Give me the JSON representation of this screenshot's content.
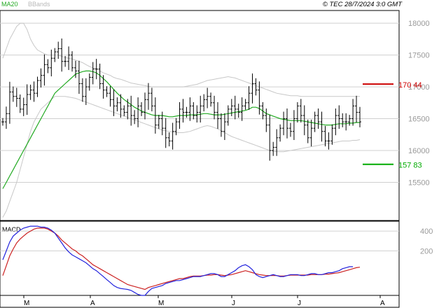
{
  "header": {
    "legend_ma": "MA20",
    "legend_bb": "BBands",
    "copyright": "© TEC 28/7/2024 3:0 GMT"
  },
  "colors": {
    "ma": "#22aa22",
    "bb": "#c8c8c8",
    "price": "#000000",
    "macd": "#2222dd",
    "signal": "#cc2222",
    "resistance": "#cc0000",
    "support": "#00aa00",
    "grid": "#d0d0d0",
    "axis_text": "#9a9a9a"
  },
  "chart_data": [
    {
      "type": "ohlc",
      "price_ticks": [
        15500,
        16000,
        16500,
        17000,
        17500,
        18000
      ],
      "price_tick_labels": [
        "15500",
        "16000",
        "16500",
        "17000",
        "17500",
        "18000"
      ],
      "ylim": [
        14900,
        18200
      ],
      "x_labels": [
        "M",
        "A",
        "M",
        "J",
        "J",
        "A"
      ],
      "levels": [
        {
          "name": "resistance",
          "value": 17044,
          "label": "170 44"
        },
        {
          "name": "support",
          "value": 15783,
          "label": "157 83"
        }
      ],
      "close": [
        16450,
        16580,
        16920,
        16850,
        16820,
        16650,
        16720,
        16880,
        16950,
        16900,
        17100,
        17180,
        17350,
        17300,
        17450,
        17550,
        17600,
        17400,
        17400,
        17500,
        17300,
        17250,
        17050,
        16850,
        17000,
        17150,
        17280,
        17280,
        17050,
        16950,
        16900,
        16800,
        16700,
        16750,
        16650,
        16600,
        16700,
        16550,
        16500,
        16700,
        16600,
        16800,
        16900,
        16700,
        16400,
        16500,
        16350,
        16200,
        16150,
        16300,
        16450,
        16650,
        16600,
        16600,
        16700,
        16550,
        16600,
        16700,
        16800,
        16850,
        16750,
        16600,
        16500,
        16300,
        16450,
        16650,
        16700,
        16650,
        16600,
        16700,
        16750,
        16900,
        17050,
        16950,
        16700,
        16550,
        16400,
        16000,
        16050,
        16200,
        16350,
        16500,
        16350,
        16300,
        16500,
        16700,
        16550,
        16400,
        16200,
        16350,
        16550,
        16450,
        16300,
        16150,
        16150,
        16350,
        16550,
        16500,
        16450,
        16450,
        16500,
        16700,
        16600,
        16450
      ],
      "ma20": [
        15400,
        15500,
        15600,
        15700,
        15800,
        15900,
        16000,
        16100,
        16200,
        16300,
        16400,
        16500,
        16600,
        16700,
        16800,
        16900,
        16950,
        17000,
        17050,
        17100,
        17150,
        17200,
        17220,
        17240,
        17250,
        17250,
        17240,
        17220,
        17180,
        17130,
        17080,
        17020,
        16960,
        16900,
        16850,
        16800,
        16760,
        16720,
        16680,
        16650,
        16620,
        16600,
        16580,
        16560,
        16550,
        16550,
        16550,
        16540,
        16530,
        16530,
        16540,
        16550,
        16550,
        16550,
        16560,
        16560,
        16560,
        16570,
        16580,
        16580,
        16570,
        16560,
        16560,
        16560,
        16570,
        16580,
        16590,
        16600,
        16610,
        16620,
        16630,
        16650,
        16680,
        16680,
        16660,
        16620,
        16580,
        16560,
        16540,
        16520,
        16500,
        16490,
        16480,
        16470,
        16470,
        16470,
        16470,
        16460,
        16450,
        16440,
        16430,
        16420,
        16410,
        16400,
        16400,
        16400,
        16410,
        16420,
        16420,
        16420,
        16430,
        16430,
        16440,
        16440
      ],
      "bb_upper": [
        17450,
        17600,
        17750,
        17850,
        17950,
        18000,
        18000,
        17900,
        17750,
        17650,
        17580,
        17550,
        17520,
        17500,
        17500,
        17500,
        17500,
        17480,
        17460,
        17450,
        17440,
        17420,
        17400,
        17380,
        17350,
        17320,
        17300,
        17280,
        17250,
        17220,
        17200,
        17180,
        17150,
        17130,
        17120,
        17100,
        17080,
        17060,
        17050,
        17040,
        17030,
        17020,
        17010,
        17000,
        17000,
        17000,
        17000,
        17000,
        17000,
        17000,
        17000,
        17000,
        17000,
        17010,
        17020,
        17030,
        17040,
        17060,
        17080,
        17100,
        17110,
        17120,
        17130,
        17140,
        17150,
        17160,
        17150,
        17140,
        17120,
        17100,
        17080,
        17060,
        17040,
        17020,
        17000,
        16980,
        16960,
        16940,
        16920,
        16900,
        16890,
        16880,
        16870,
        16860,
        16860,
        16860,
        16850,
        16850,
        16850,
        16850,
        16850,
        16850,
        16850,
        16850,
        16850,
        16850,
        16850,
        16850,
        16850,
        16850,
        16850,
        16850,
        16850,
        16850
      ],
      "bb_lower": [
        14950,
        15050,
        15200,
        15350,
        15500,
        15700,
        15900,
        16100,
        16300,
        16450,
        16550,
        16650,
        16700,
        16750,
        16800,
        16850,
        16850,
        16850,
        16850,
        16840,
        16830,
        16820,
        16800,
        16780,
        16760,
        16740,
        16720,
        16700,
        16680,
        16660,
        16640,
        16620,
        16600,
        16580,
        16560,
        16540,
        16520,
        16500,
        16480,
        16460,
        16440,
        16420,
        16400,
        16380,
        16360,
        16340,
        16320,
        16310,
        16300,
        16290,
        16280,
        16280,
        16280,
        16290,
        16300,
        16320,
        16340,
        16360,
        16380,
        16390,
        16380,
        16360,
        16340,
        16310,
        16280,
        16250,
        16220,
        16200,
        16180,
        16160,
        16140,
        16120,
        16100,
        16080,
        16060,
        16040,
        16020,
        16000,
        15990,
        15980,
        15980,
        15980,
        15990,
        16000,
        16010,
        16020,
        16030,
        16040,
        16050,
        16060,
        16070,
        16080,
        16090,
        16100,
        16110,
        16120,
        16130,
        16140,
        16150,
        16150,
        16150,
        16160,
        16160,
        16170
      ]
    },
    {
      "type": "line",
      "title": "MACD",
      "y_ticks": [
        200,
        400
      ],
      "y_tick_labels": [
        "200",
        "400"
      ],
      "ylim": [
        -250,
        500
      ],
      "macd": [
        110,
        200,
        290,
        350,
        380,
        410,
        430,
        440,
        450,
        450,
        450,
        440,
        440,
        430,
        410,
        380,
        330,
        280,
        230,
        190,
        160,
        140,
        120,
        100,
        80,
        50,
        20,
        0,
        -30,
        -60,
        -90,
        -120,
        -150,
        -170,
        -180,
        -185,
        -190,
        -200,
        -220,
        -240,
        -250,
        -250,
        -210,
        -180,
        -170,
        -160,
        -150,
        -130,
        -120,
        -110,
        -100,
        -100,
        -90,
        -80,
        -70,
        -60,
        -60,
        -60,
        -50,
        -40,
        -30,
        -30,
        -40,
        -60,
        -60,
        -40,
        -20,
        0,
        30,
        50,
        60,
        40,
        10,
        -40,
        -60,
        -70,
        -60,
        -50,
        -40,
        -50,
        -60,
        -60,
        -50,
        -40,
        -40,
        -40,
        -50,
        -50,
        -40,
        -30,
        -30,
        -40,
        -40,
        -30,
        -20,
        -20,
        -10,
        0,
        20,
        30,
        40,
        40
      ],
      "signal": [
        -50,
        50,
        150,
        220,
        280,
        320,
        350,
        380,
        400,
        420,
        430,
        430,
        430,
        420,
        400,
        380,
        350,
        310,
        280,
        250,
        220,
        200,
        170,
        150,
        120,
        90,
        60,
        40,
        20,
        0,
        -20,
        -40,
        -60,
        -80,
        -100,
        -120,
        -140,
        -150,
        -160,
        -170,
        -180,
        -190,
        -170,
        -160,
        -150,
        -140,
        -130,
        -120,
        -110,
        -100,
        -90,
        -80,
        -80,
        -70,
        -60,
        -55,
        -55,
        -55,
        -50,
        -45,
        -45,
        -40,
        -40,
        -45,
        -50,
        -45,
        -40,
        -30,
        -20,
        -10,
        0,
        -10,
        -20,
        -30,
        -40,
        -45,
        -50,
        -50,
        -50,
        -50,
        -55,
        -55,
        -50,
        -45,
        -45,
        -45,
        -45,
        -45,
        -45,
        -40,
        -40,
        -40,
        -40,
        -35,
        -35,
        -30,
        -25,
        -20,
        -10,
        0,
        10,
        20,
        30,
        35
      ]
    }
  ]
}
